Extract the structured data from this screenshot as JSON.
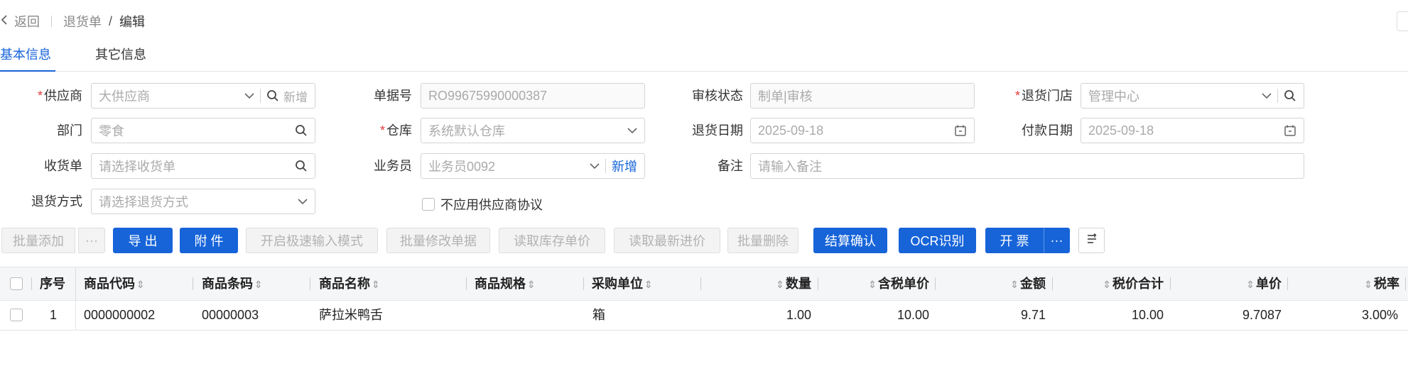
{
  "breadcrumb": {
    "back": "返回",
    "parent": "退货单",
    "current": "编辑",
    "slash": "/"
  },
  "tabs": [
    {
      "label": "基本信息",
      "active": true
    },
    {
      "label": "其它信息",
      "active": false
    }
  ],
  "form": {
    "supplier": {
      "label": "供应商",
      "value": "大供应商",
      "add_label": "新增"
    },
    "doc_no": {
      "label": "单据号",
      "value": "RO99675990000387"
    },
    "audit_status": {
      "label": "审核状态",
      "value": "制单|审核"
    },
    "return_store": {
      "label": "退货门店",
      "value": "管理中心"
    },
    "department": {
      "label": "部门",
      "value": "零食"
    },
    "warehouse": {
      "label": "仓库",
      "value": "系统默认仓库"
    },
    "return_date": {
      "label": "退货日期",
      "value": "2025-09-18"
    },
    "pay_date": {
      "label": "付款日期",
      "value": "2025-09-18"
    },
    "receipt": {
      "label": "收货单",
      "placeholder": "请选择收货单"
    },
    "salesman": {
      "label": "业务员",
      "value": "业务员0092",
      "add_label": "新增"
    },
    "remark": {
      "label": "备注",
      "placeholder": "请输入备注"
    },
    "return_method": {
      "label": "退货方式",
      "placeholder": "请选择退货方式"
    },
    "no_protocol": {
      "label": "不应用供应商协议",
      "checked": false
    }
  },
  "toolbar": {
    "batch_add": "批量添加",
    "more": "···",
    "export": "导 出",
    "attach": "附 件",
    "fast_input": "开启极速输入模式",
    "batch_edit": "批量修改单据",
    "read_stock_price": "读取库存单价",
    "read_latest_price": "读取最新进价",
    "batch_delete": "批量删除",
    "settle": "结算确认",
    "ocr": "OCR识别",
    "invoice": "开 票",
    "invoice_more": "···"
  },
  "table": {
    "headers": [
      "序号",
      "商品代码",
      "商品条码",
      "商品名称",
      "商品规格",
      "采购单位",
      "数量",
      "含税单价",
      "金额",
      "税价合计",
      "单价",
      "税率"
    ],
    "rows": [
      {
        "seq": "1",
        "code": "0000000002",
        "barcode": "00000003",
        "name": "萨拉米鸭舌",
        "spec": "",
        "unit": "箱",
        "qty": "1.00",
        "tax_price": "10.00",
        "amount": "9.71",
        "total": "10.00",
        "price": "9.7087",
        "rate": "3.00%"
      }
    ]
  },
  "colors": {
    "primary": "#1764d9",
    "required": "#e53935"
  }
}
